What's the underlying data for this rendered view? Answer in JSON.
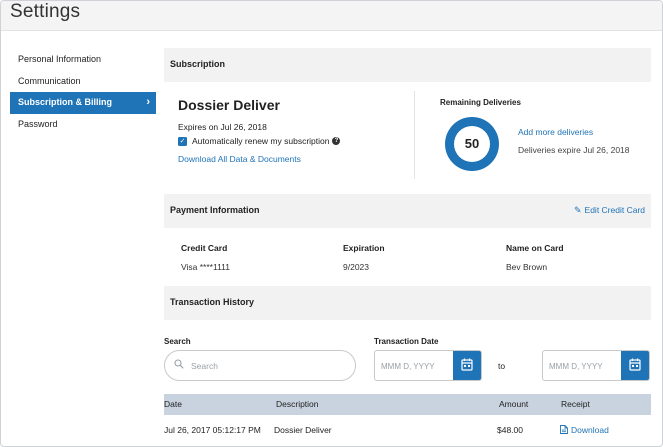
{
  "header": {
    "title": "Settings"
  },
  "sidebar": {
    "items": [
      {
        "label": "Personal Information"
      },
      {
        "label": "Communication"
      },
      {
        "label": "Subscription & Billing"
      },
      {
        "label": "Password"
      }
    ],
    "active_chevron": "›"
  },
  "subscription": {
    "section_title": "Subscription",
    "plan_name": "Dossier Deliver",
    "expires": "Expires on Jul 26, 2018",
    "auto_renew_label": "Automatically renew my subscription",
    "auto_renew_checked": true,
    "help_glyph": "?",
    "download_all": "Download All Data & Documents",
    "remaining_title": "Remaining Deliveries",
    "remaining_count": "50",
    "add_more": "Add more deliveries",
    "deliveries_expire": "Deliveries expire Jul 26, 2018"
  },
  "payment": {
    "section_title": "Payment Information",
    "edit_label": "Edit Credit Card",
    "credit_card_label": "Credit Card",
    "credit_card_value": "Visa ****1111",
    "expiration_label": "Expiration",
    "expiration_value": "9/2023",
    "name_label": "Name on Card",
    "name_value": "Bev Brown"
  },
  "transactions": {
    "section_title": "Transaction History",
    "search_label": "Search",
    "search_placeholder": "Search",
    "search_value": "",
    "date_label": "Transaction Date",
    "date_from_placeholder": "MMM D, YYYY",
    "date_to_placeholder": "MMM D, YYYY",
    "to_label": "to",
    "columns": {
      "date": "Date",
      "description": "Description",
      "amount": "Amount",
      "receipt": "Receipt"
    },
    "rows": [
      {
        "date": "Jul 26, 2017 05:12:17 PM",
        "description": "Dossier Deliver",
        "amount": "$48.00",
        "receipt": "Download"
      }
    ]
  },
  "colors": {
    "accent": "#1f73b7",
    "section_bg": "#f2f2f2",
    "table_header_bg": "#c8d3df"
  },
  "icons": [
    "chevron-right-icon",
    "checkbox-checked-icon",
    "help-icon",
    "pencil-icon",
    "search-icon",
    "calendar-icon",
    "document-icon"
  ]
}
